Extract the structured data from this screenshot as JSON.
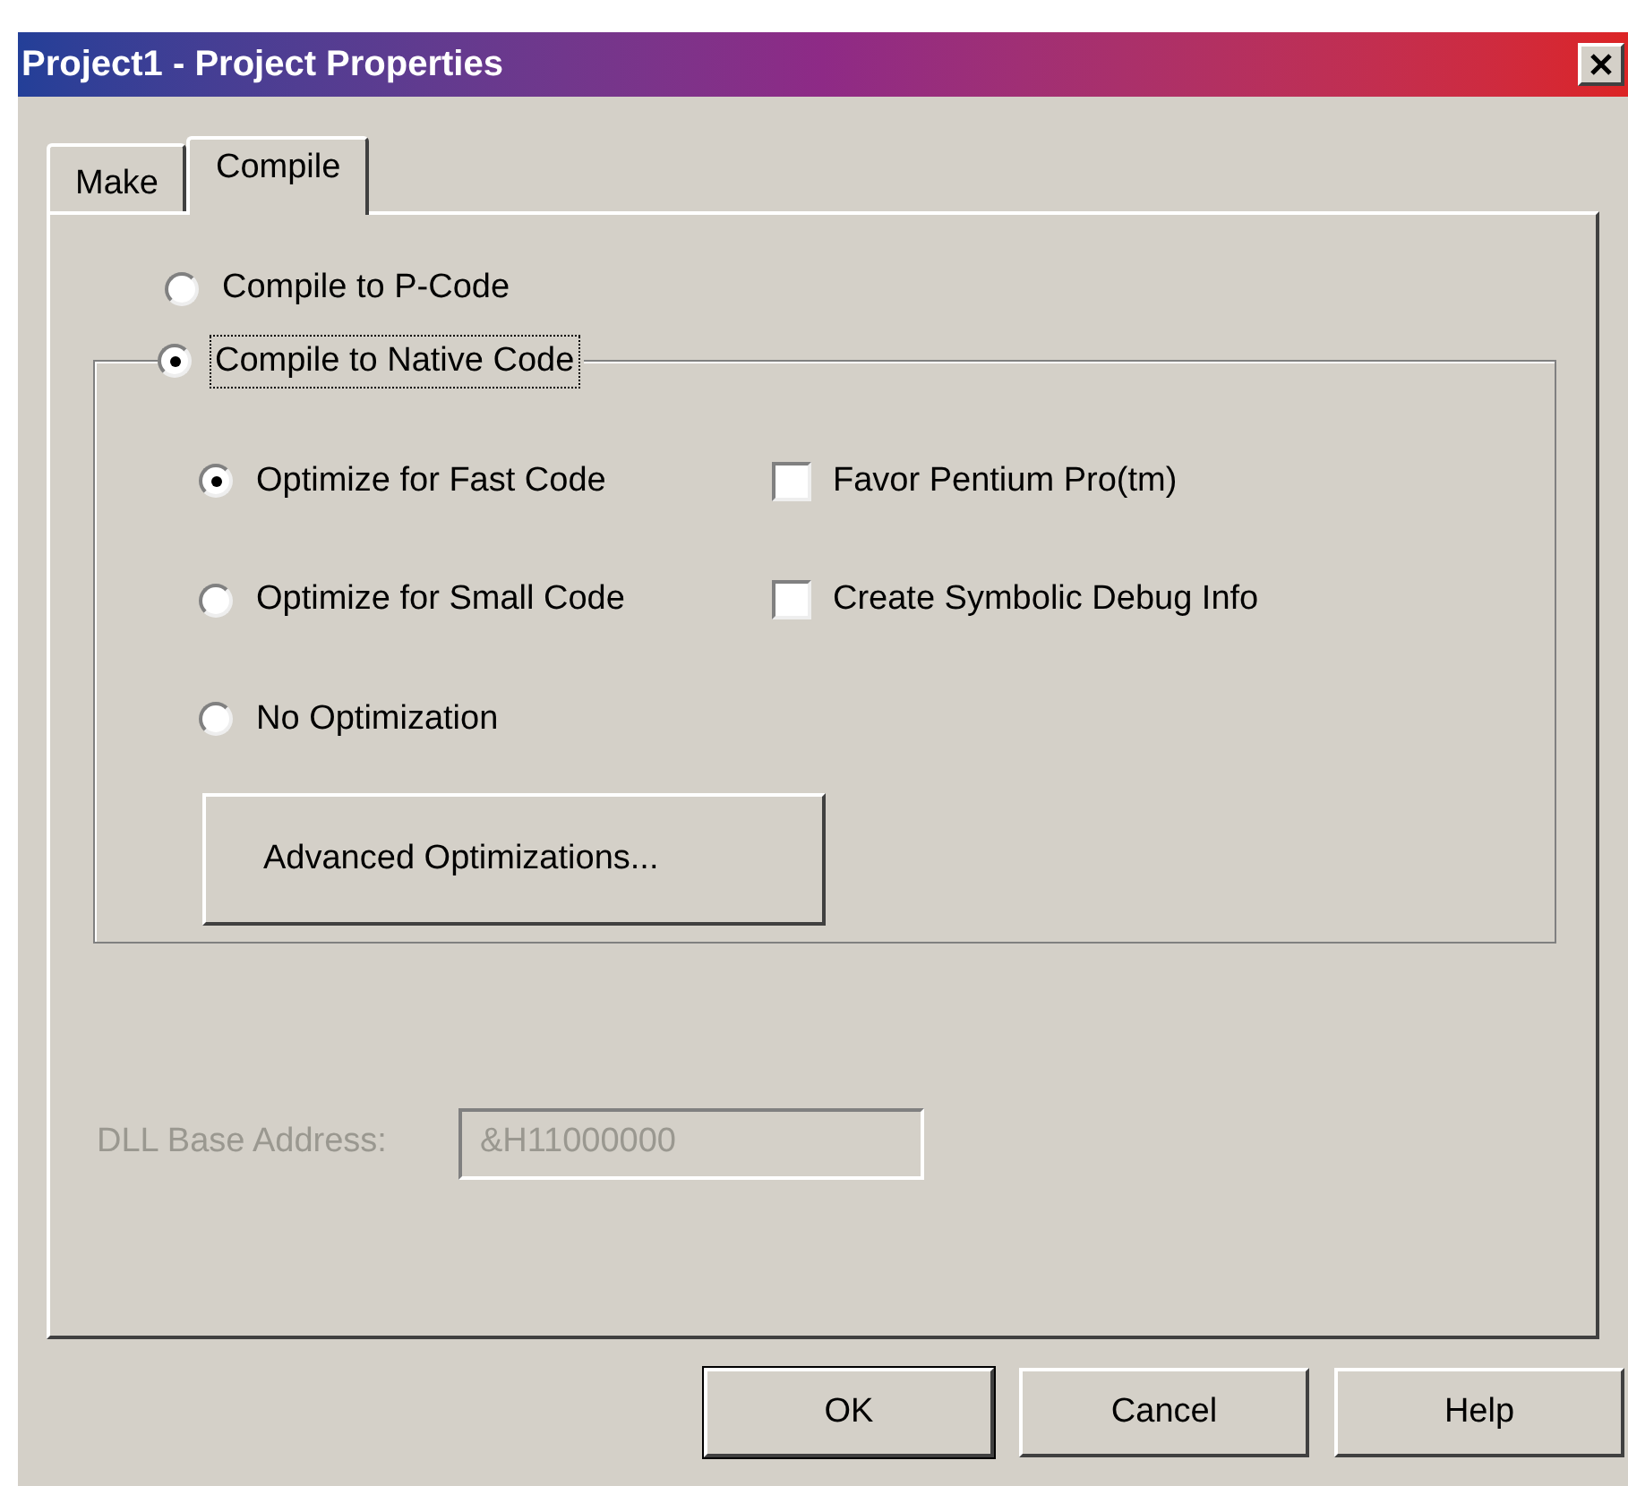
{
  "window": {
    "title": "Project1 - Project Properties"
  },
  "tabs": [
    {
      "label": "Make",
      "selected": false
    },
    {
      "label": "Compile",
      "selected": true
    }
  ],
  "compile_mode": [
    {
      "label": "Compile to P-Code",
      "selected": false
    },
    {
      "label": "Compile to Native Code",
      "selected": true
    }
  ],
  "optimization": [
    {
      "label": "Optimize for Fast Code",
      "selected": true
    },
    {
      "label": "Optimize for Small Code",
      "selected": false
    },
    {
      "label": "No Optimization",
      "selected": false
    }
  ],
  "options": [
    {
      "label": "Favor Pentium Pro(tm)",
      "checked": false
    },
    {
      "label": "Create Symbolic Debug Info",
      "checked": false
    }
  ],
  "advanced_button": "Advanced Optimizations...",
  "dll_base_address": {
    "label": "DLL Base Address:",
    "value": "&H11000000",
    "disabled": true
  },
  "buttons": [
    {
      "label": "OK",
      "default": true
    },
    {
      "label": "Cancel",
      "default": false
    },
    {
      "label": "Help",
      "default": false
    }
  ]
}
